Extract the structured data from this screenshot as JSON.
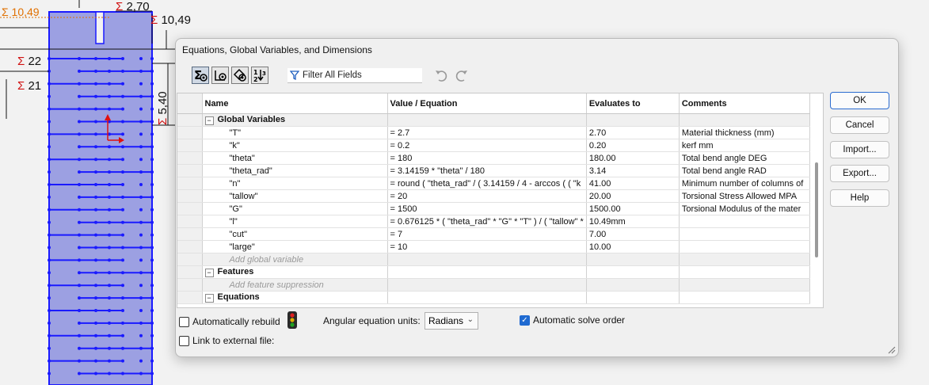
{
  "cad": {
    "dims": [
      "10,49",
      "2,70",
      "10,49",
      "22",
      "21",
      "5,40"
    ],
    "sigma": "Σ"
  },
  "dialog": {
    "title": "Equations, Global Variables, and Dimensions",
    "toolbar": {
      "buttons": [
        "equation-view-icon",
        "sketch-equation-view-icon",
        "dimension-view-icon",
        "ordered-view-icon"
      ],
      "filter_placeholder": "Filter All Fields"
    },
    "table": {
      "headers": [
        "Name",
        "Value / Equation",
        "Evaluates to",
        "Comments"
      ],
      "global_group": "Global Variables",
      "variables": [
        {
          "name": "\"T\"",
          "equation": "= 2.7",
          "evaluates": "2.70",
          "comment": "Material thickness (mm)"
        },
        {
          "name": "\"k\"",
          "equation": "= 0.2",
          "evaluates": "0.20",
          "comment": "kerf mm"
        },
        {
          "name": "\"theta\"",
          "equation": "= 180",
          "evaluates": "180.00",
          "comment": "Total bend angle DEG"
        },
        {
          "name": "\"theta_rad\"",
          "equation": "= 3.14159 * \"theta\" / 180",
          "evaluates": "3.14",
          "comment": "Total bend angle RAD"
        },
        {
          "name": "\"n\"",
          "equation": "= round ( \"theta_rad\" / ( 3.14159 / 4 - arccos ( ( \"k",
          "evaluates": "41.00",
          "comment": "Minimum number of columns of"
        },
        {
          "name": "\"tallow\"",
          "equation": "= 20",
          "evaluates": "20.00",
          "comment": "Torsional Stress Allowed MPA"
        },
        {
          "name": "\"G\"",
          "equation": "= 1500",
          "evaluates": "1500.00",
          "comment": "Torsional Modulus of the mater"
        },
        {
          "name": "\"l\"",
          "equation": "= 0.676125 * ( \"theta_rad\" * \"G\" * \"T\" ) / ( \"tallow\" *",
          "evaluates": "10.49mm",
          "comment": ""
        },
        {
          "name": "\"cut\"",
          "equation": "= 7",
          "evaluates": "7.00",
          "comment": ""
        },
        {
          "name": "\"large\"",
          "equation": "= 10",
          "evaluates": "10.00",
          "comment": ""
        }
      ],
      "add_global": "Add global variable",
      "features_group": "Features",
      "add_feature": "Add feature suppression",
      "equations_group": "Equations"
    },
    "bottom": {
      "auto_rebuild": "Automatically rebuild",
      "angular_units_label": "Angular equation units:",
      "angular_units_value": "Radians",
      "auto_solve": "Automatic solve order",
      "link_external": "Link to external file:"
    },
    "buttons": {
      "ok": "OK",
      "cancel": "Cancel",
      "import": "Import...",
      "export": "Export...",
      "help": "Help"
    },
    "colors": {
      "accent": "#1f6ad1",
      "cad_blue": "#1a1aff",
      "cad_fill": "#9a9ee0",
      "dim_red": "#d01010",
      "dim_orange": "#e07000"
    }
  }
}
